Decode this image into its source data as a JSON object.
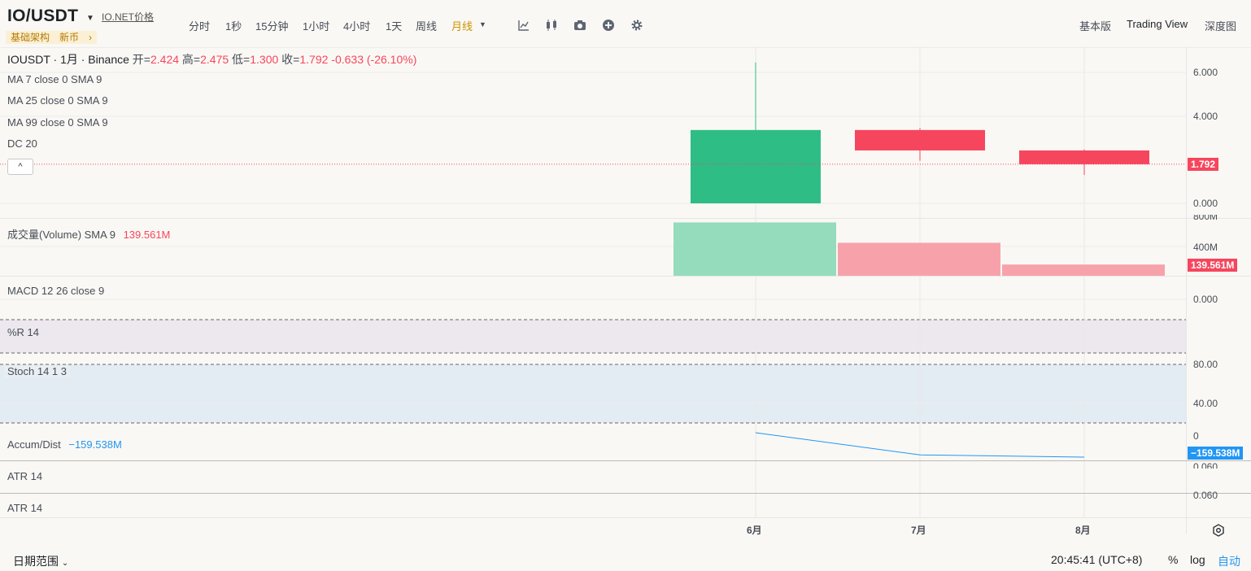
{
  "header": {
    "symbol": "IO/USDT",
    "price_link": "IO.NET价格",
    "tags": [
      "基础架构",
      "新币"
    ],
    "tag_arrow": "›",
    "intervals": [
      "分时",
      "1秒",
      "15分钟",
      "1小时",
      "4小时",
      "1天",
      "周线",
      "月线"
    ],
    "active_interval": "月线",
    "tools": [
      "indicator-icon",
      "candle-type-icon",
      "camera-icon",
      "plus-circle-icon",
      "settings-icon"
    ],
    "views": [
      "基本版",
      "Trading View",
      "深度图"
    ],
    "active_view": "Trading View"
  },
  "legend": {
    "title": "IOUSDT · 1月 · Binance",
    "open_label": "开=",
    "open": "2.424",
    "high_label": "高=",
    "high": "2.475",
    "low_label": "低=",
    "low": "1.300",
    "close_label": "收=",
    "close": "1.792",
    "change": "-0.633 (-26.10%)",
    "indicators": [
      "MA 7 close 0 SMA 9",
      "MA 25 close 0 SMA 9",
      "MA 99 close 0 SMA 9",
      "DC 20"
    ],
    "collapse_icon": "^"
  },
  "panes": {
    "volume_label": "成交量(Volume) SMA 9",
    "volume_value": "139.561M",
    "macd_label": "MACD 12 26 close 9",
    "wr_label": "%R 14",
    "stoch_label": "Stoch 14 1 3",
    "ad_label": "Accum/Dist",
    "ad_value": "−159.538M",
    "atr_label_1": "ATR 14",
    "atr_label_2": "ATR 14"
  },
  "axis": {
    "price_ticks": [
      "6.000",
      "4.000",
      "0.000"
    ],
    "volume_ticks": [
      "800M",
      "400M"
    ],
    "macd_tick": "0.000",
    "stoch_ticks": [
      "80.00",
      "40.00"
    ],
    "ad_tick": "0",
    "atr_ticks": [
      "0.060",
      "0.060"
    ],
    "last_price_tag": "1.792",
    "volume_tag": "139.561M",
    "ad_tag": "−159.538M",
    "time_labels": [
      "6月",
      "7月",
      "8月"
    ]
  },
  "footer": {
    "date_range": "日期范围",
    "time": "20:45:41 (UTC+8)",
    "percent": "%",
    "log": "log",
    "auto": "自动"
  },
  "colors": {
    "up": "#2ebd85",
    "down": "#f6465d",
    "accent": "#c99400",
    "ad_line": "#2196f3"
  },
  "chart_data": [
    {
      "type": "candlestick",
      "title": "IOUSDT · 1月 · Binance",
      "categories": [
        "6月",
        "7月",
        "8月"
      ],
      "open": [
        0.0,
        3.36,
        2.424
      ],
      "high": [
        6.45,
        3.45,
        2.475
      ],
      "low": [
        0.0,
        1.95,
        1.3
      ],
      "close": [
        3.36,
        2.424,
        1.792
      ],
      "last": 1.792,
      "ylim": [
        0,
        6.5
      ]
    },
    {
      "type": "bar",
      "title": "成交量(Volume) SMA 9",
      "categories": [
        "6月",
        "7月",
        "8月"
      ],
      "values": [
        760,
        470,
        160
      ],
      "unit": "M",
      "ylim": [
        0,
        800
      ]
    },
    {
      "type": "line",
      "title": "Accum/Dist",
      "x": [
        "6月",
        "7月",
        "8月"
      ],
      "values": [
        0,
        -145,
        -159.538
      ],
      "unit": "M"
    }
  ]
}
